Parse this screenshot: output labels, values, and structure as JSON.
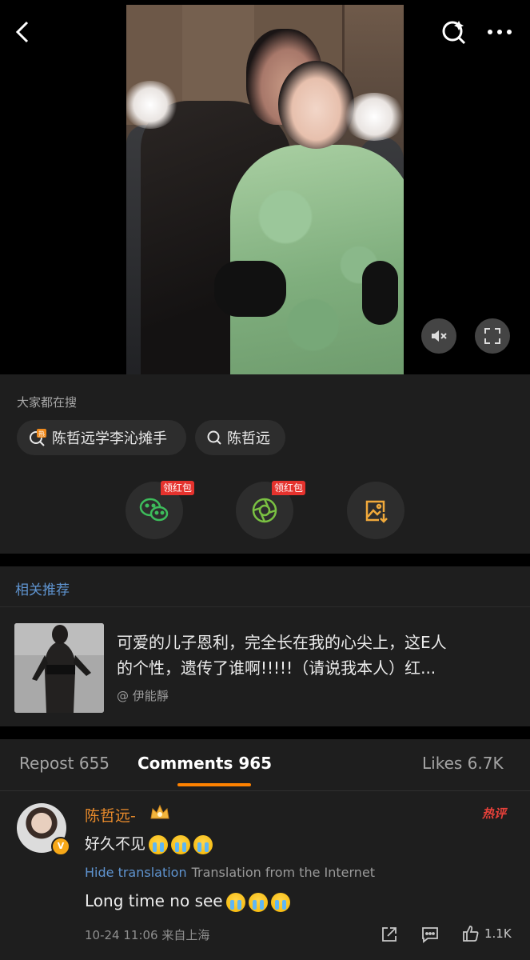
{
  "search": {
    "heading": "大家都在搜",
    "items": [
      {
        "label": "陈哲远学李沁摊手",
        "icon": "hot-search-icon"
      },
      {
        "label": "陈哲远",
        "icon": "search-icon"
      }
    ]
  },
  "share": {
    "badge_label": "领红包",
    "buttons": [
      {
        "icon": "wechat-icon",
        "color": "#3dbd5b"
      },
      {
        "icon": "moments-icon",
        "color": "#7ac142"
      },
      {
        "icon": "save-image-icon",
        "color": "#f0a93b"
      }
    ]
  },
  "related": {
    "heading": "相关推荐",
    "line1": "可爱的儿子恩利，完全长在我的心尖上，这E人",
    "line2": "的个性，遗传了谁啊!!!!!（请说我本人）红...",
    "author": "@ 伊能靜"
  },
  "tabs": {
    "repost": "Repost 655",
    "comments": "Comments 965",
    "likes": "Likes 6.7K",
    "accent": "#ff8200"
  },
  "comment": {
    "name": "陈哲远-",
    "hot_tag": "热评",
    "text": "好久不见",
    "hide_translation": "Hide translation",
    "translation_source": "Translation from the Internet",
    "translated": "Long time no see",
    "time": "10-24 11:06",
    "location": "来自上海",
    "likes": "1.1K",
    "verified": "V"
  }
}
